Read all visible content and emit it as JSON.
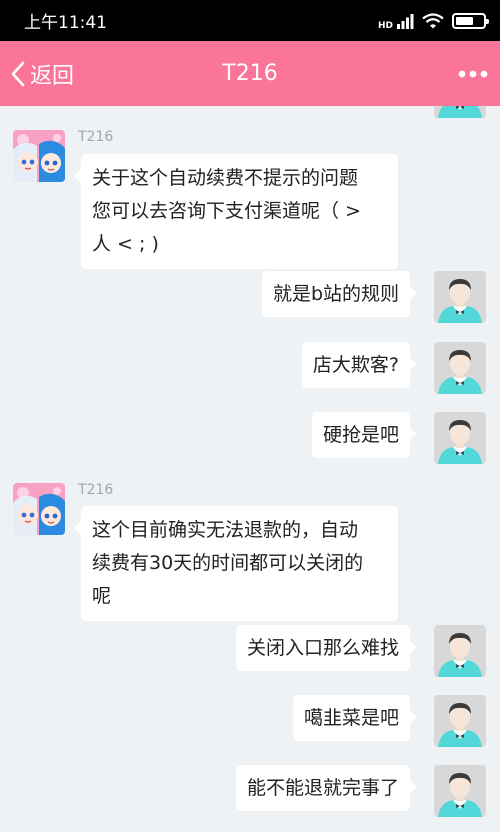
{
  "status_bar": {
    "time": "上午11:41",
    "network": "HD",
    "battery_level": 0.65
  },
  "header": {
    "back_label": "返回",
    "title": "T216"
  },
  "colors": {
    "brand": "#fa7597",
    "background": "#eef2f4",
    "bubble": "#ffffff",
    "user_avatar_bg": "#d8d8d8",
    "user_avatar_shirt": "#52d8d8"
  },
  "messages": [
    {
      "side": "left",
      "sender": "T216",
      "text": "关于这个自动续费不提示的问题\n您可以去咨询下支付渠道呢（ >\n人 < ; )"
    },
    {
      "side": "right",
      "text": "就是b站的规则"
    },
    {
      "side": "right",
      "text": "店大欺客?"
    },
    {
      "side": "right",
      "text": "硬抢是吧"
    },
    {
      "side": "left",
      "sender": "T216",
      "text": "这个目前确实无法退款的，自动\n续费有30天的时间都可以关闭的\n呢"
    },
    {
      "side": "right",
      "text": "关闭入口那么难找"
    },
    {
      "side": "right",
      "text": "噶韭菜是吧"
    },
    {
      "side": "right",
      "text": "能不能退就完事了"
    }
  ]
}
